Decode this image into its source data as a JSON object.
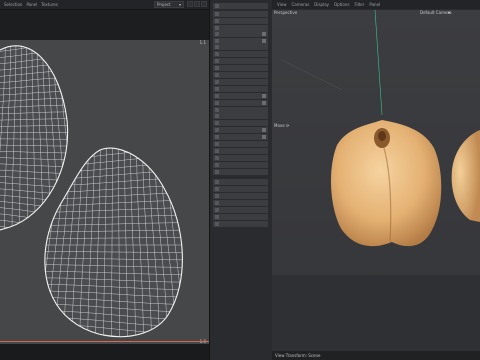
{
  "uv_editor": {
    "menu": [
      "Selection",
      "Panel",
      "Textures"
    ],
    "uv_set_select": "Project",
    "corner_top": "1.1",
    "corner_bottom": "1.0"
  },
  "tool_panel": {
    "items": [
      "",
      "",
      "",
      "",
      "",
      "",
      "",
      "",
      "",
      "",
      "",
      "",
      "",
      "",
      "",
      "",
      "",
      "",
      "",
      "",
      "",
      "",
      "",
      "",
      "",
      "",
      "",
      "",
      "",
      "",
      "",
      ""
    ]
  },
  "viewport": {
    "menu": [
      "View",
      "Cameras",
      "Display",
      "Options",
      "Filter",
      "Panel"
    ],
    "camera_label": "Perspective",
    "default_camera": "Default Camera",
    "mode_label": "Move",
    "status": "View Transform: Scene"
  },
  "colors": {
    "uv_background": "#464749",
    "uv_wire": "#e6e6e6",
    "object_skin": "#e9b97e",
    "object_shadow": "#b47f47",
    "camera_line": "#3fbf8f"
  }
}
